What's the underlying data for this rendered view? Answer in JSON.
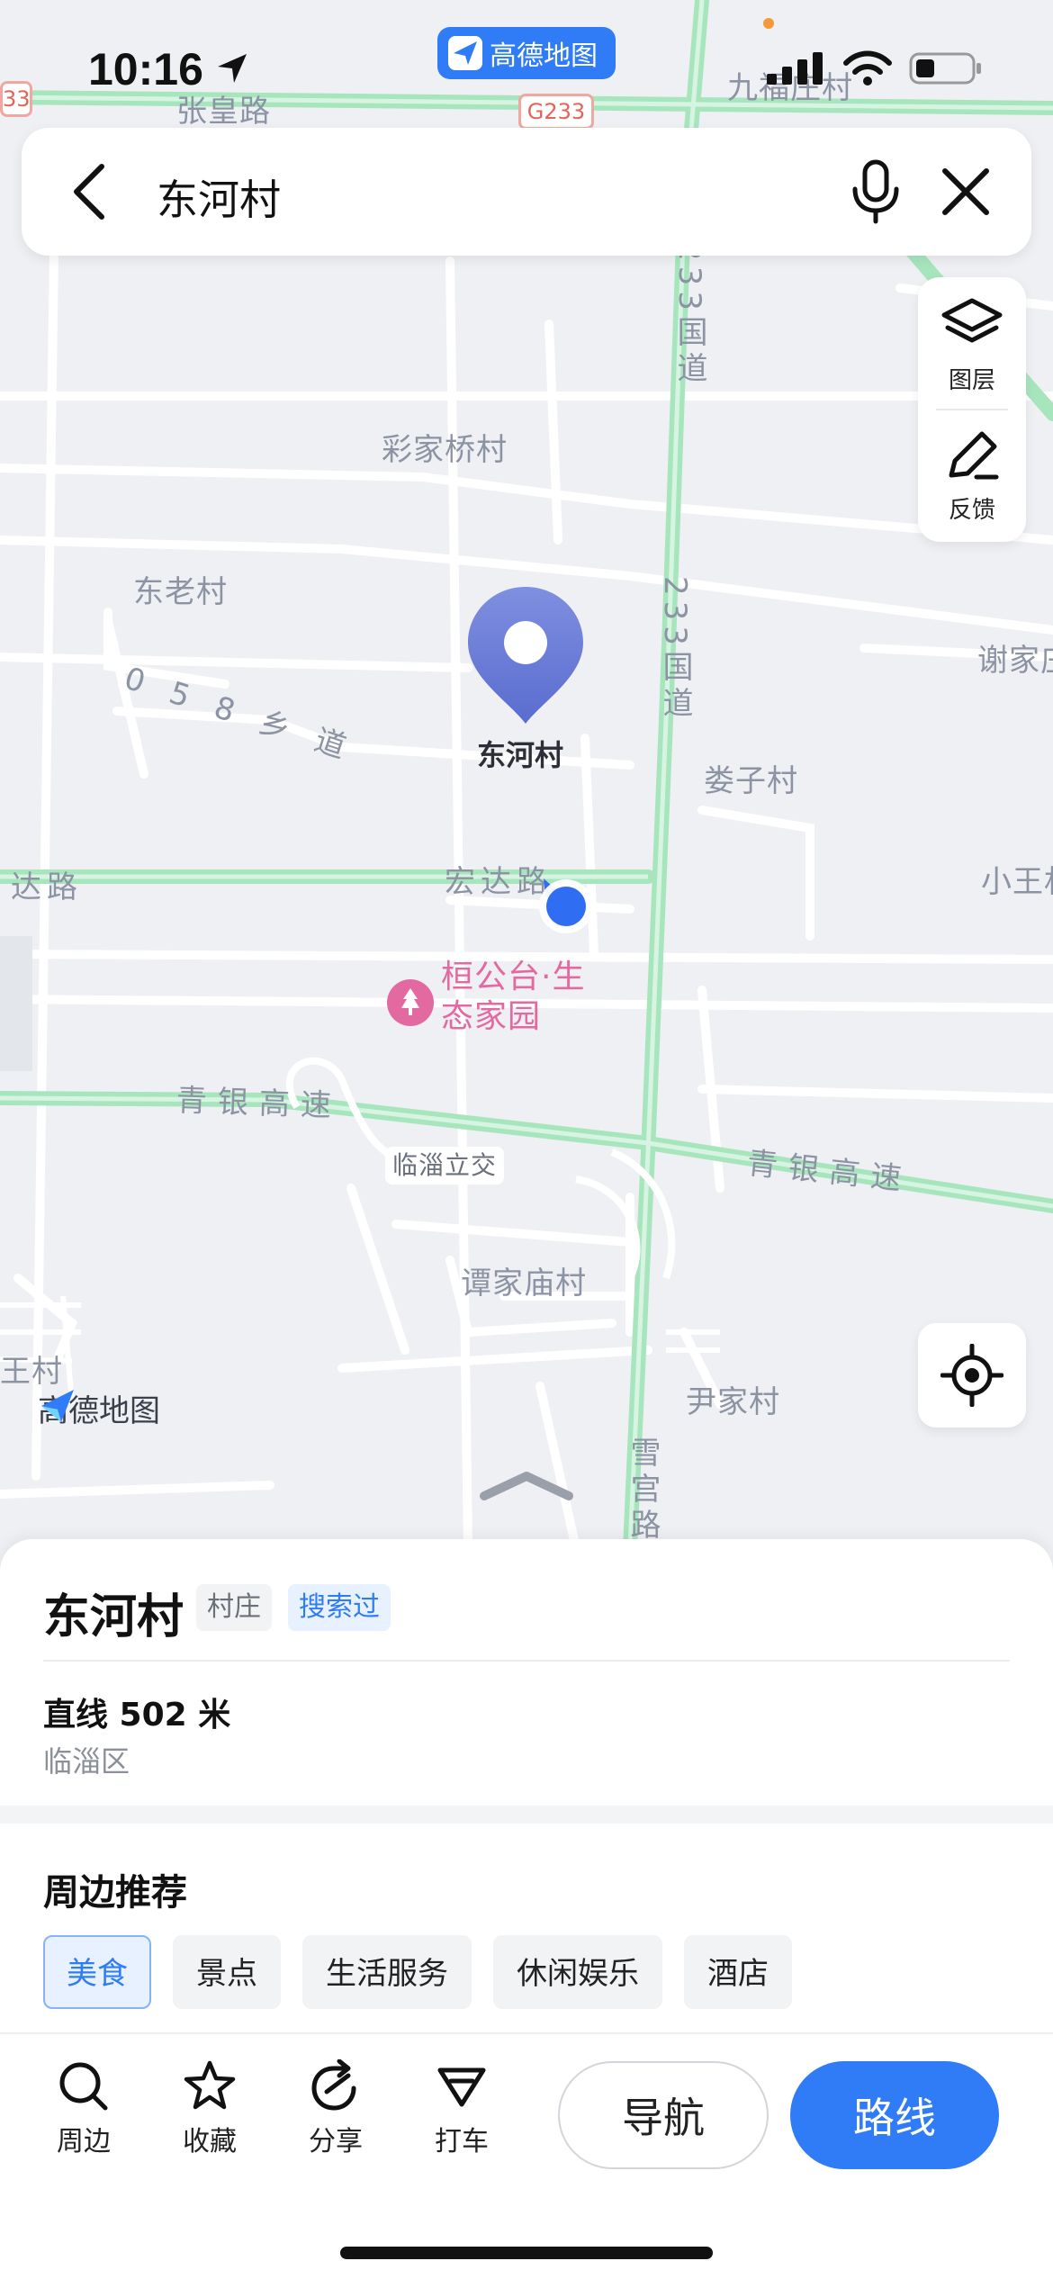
{
  "status_bar": {
    "time": "10:16",
    "app_pill_label": "高德地图"
  },
  "search": {
    "query": "东河村"
  },
  "map_tools": {
    "layers_label": "图层",
    "feedback_label": "反馈"
  },
  "map": {
    "logo_text": "高德地图",
    "selected_pin_label": "东河村",
    "labels": {
      "zhanghuang_road": "张皇路",
      "g233_shield": "G233",
      "jiuhuangzhuang_village": "九福庄村",
      "caijiaqiao_village": "彩家桥村",
      "donglao_village": "东老村",
      "road_058": "0 5 8 乡 道",
      "national_road_233_upper": "233国道",
      "national_road_233_mid": "233国道",
      "xiejia_village": "谢家庄",
      "louzi_village": "娄子村",
      "hongda_road": "宏达路",
      "hongda_road_left": "达路",
      "xiaowang_village": "小王村",
      "huangongtai_park": "桓公台·生态家园",
      "qingyin_expressway_left": "青银高速",
      "qingyin_expressway_right": "青银高速",
      "linzi_interchange": "临淄立交",
      "tanjiamiao_village": "谭家庙村",
      "left_edge_village": "王村",
      "yinjia_village": "尹家村",
      "xuegong_road": "雪宫路",
      "left_edge_road_shield": "33"
    }
  },
  "place": {
    "name": "东河村",
    "type_tag": "村庄",
    "searched_tag": "搜索过",
    "distance": "直线 502 米",
    "district": "临淄区"
  },
  "nearby": {
    "title": "周边推荐",
    "categories": [
      {
        "label": "美食",
        "active": true
      },
      {
        "label": "景点",
        "active": false
      },
      {
        "label": "生活服务",
        "active": false
      },
      {
        "label": "休闲娱乐",
        "active": false
      },
      {
        "label": "酒店",
        "active": false
      }
    ]
  },
  "actions": {
    "nearby_label": "周边",
    "favorite_label": "收藏",
    "share_label": "分享",
    "taxi_label": "打车",
    "navigate_label": "导航",
    "route_label": "路线"
  },
  "colors": {
    "accent": "#2f7cf6",
    "expressway": "#9be2b4",
    "map_bg": "#eef0f3",
    "pin": "#6c7fd8",
    "poi_pink": "#e36aa1"
  }
}
